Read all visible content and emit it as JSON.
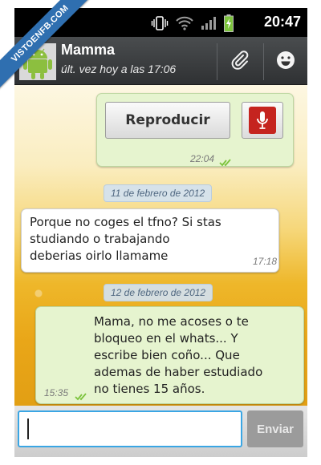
{
  "watermark": {
    "text": "VISTOENFB.COM"
  },
  "statusbar": {
    "time": "20:47",
    "icons": [
      "vibrate-icon",
      "wifi-icon",
      "signal-icon",
      "battery-charging-icon"
    ]
  },
  "header": {
    "contact_name": "Mamma",
    "last_seen": "últ. vez hoy a las 17:06",
    "icons": [
      "android-avatar-icon",
      "paperclip-icon",
      "smiley-icon"
    ]
  },
  "messages": [
    {
      "direction": "out",
      "type": "voice",
      "play_label": "Reproducir",
      "time": "22:04",
      "delivered": true
    },
    {
      "type": "date",
      "text": "11 de febrero de 2012"
    },
    {
      "direction": "in",
      "type": "text",
      "text": "Porque no coges el tfno? Si stas\nstudiando o trabajando\ndeberias oirlo llamame",
      "time": "17:18"
    },
    {
      "type": "date",
      "text": "12 de febrero de 2012"
    },
    {
      "direction": "out",
      "type": "text",
      "text": "Mama, no me acoses o te\nbloqueo en el whats... Y\nescribe bien coño... Que\nademas de haber  estudiado\nno tienes 15 años.",
      "time": "15:35",
      "delivered": true
    }
  ],
  "composer": {
    "value": "",
    "send_label": "Enviar"
  },
  "colors": {
    "outgoing_bubble": "#e6f4cf",
    "incoming_bubble": "#ffffff",
    "date_chip": "#d2e2f0",
    "tick": "#7cc33c",
    "mic": "#c5241f",
    "input_focus": "#3aa6e4"
  }
}
